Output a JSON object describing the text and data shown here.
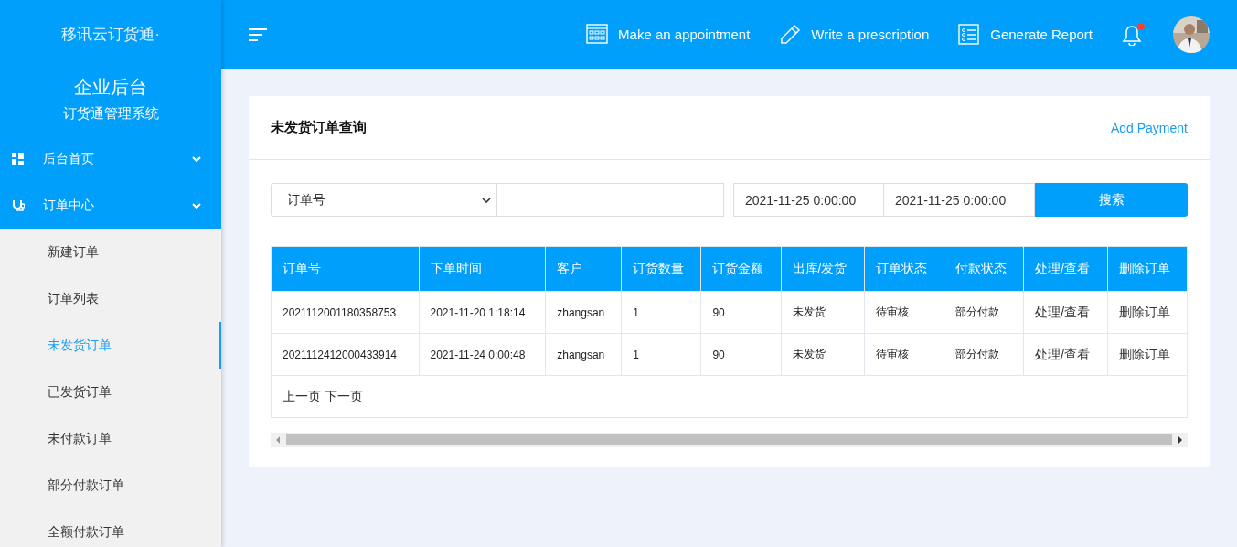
{
  "sidebar": {
    "logo": "移讯云订货通·",
    "title": "企业后台",
    "subtitle": "订货通管理系统",
    "menu": [
      {
        "label": "后台首页"
      },
      {
        "label": "订单中心",
        "children": [
          {
            "label": "新建订单",
            "selected": false
          },
          {
            "label": "订单列表",
            "selected": false
          },
          {
            "label": "未发货订单",
            "selected": true
          },
          {
            "label": "已发货订单",
            "selected": false
          },
          {
            "label": "未付款订单",
            "selected": false
          },
          {
            "label": "部分付款订单",
            "selected": false
          },
          {
            "label": "全额付款订单",
            "selected": false
          }
        ]
      }
    ]
  },
  "topbar": {
    "actions": [
      {
        "label": "Make an appointment"
      },
      {
        "label": "Write a prescription"
      },
      {
        "label": "Generate Report"
      }
    ],
    "notifications": {
      "unread": true
    }
  },
  "card": {
    "title": "未发货订单查询",
    "link": "Add Payment",
    "filter": {
      "field": "订单号",
      "date_from": "2021-11-25 0:00:00",
      "date_to": "2021-11-25 0:00:00",
      "button": "搜索"
    },
    "table": {
      "columns": [
        "订单号",
        "下单时间",
        "客户",
        "订货数量",
        "订货金额",
        "出库/发货",
        "订单状态",
        "付款状态",
        "处理/查看",
        "删除订单"
      ],
      "rows": [
        [
          "2021112001180358753",
          "2021-11-20 1:18:14",
          "zhangsan",
          "1",
          "90",
          "未发货",
          "待审核",
          "部分付款",
          "处理/查看",
          "删除订单"
        ],
        [
          "2021112412000433914",
          "2021-11-24 0:00:48",
          "zhangsan",
          "1",
          "90",
          "未发货",
          "待审核",
          "部分付款",
          "处理/查看",
          "删除订单"
        ]
      ],
      "pager": [
        "上一页",
        "下一页"
      ]
    }
  }
}
